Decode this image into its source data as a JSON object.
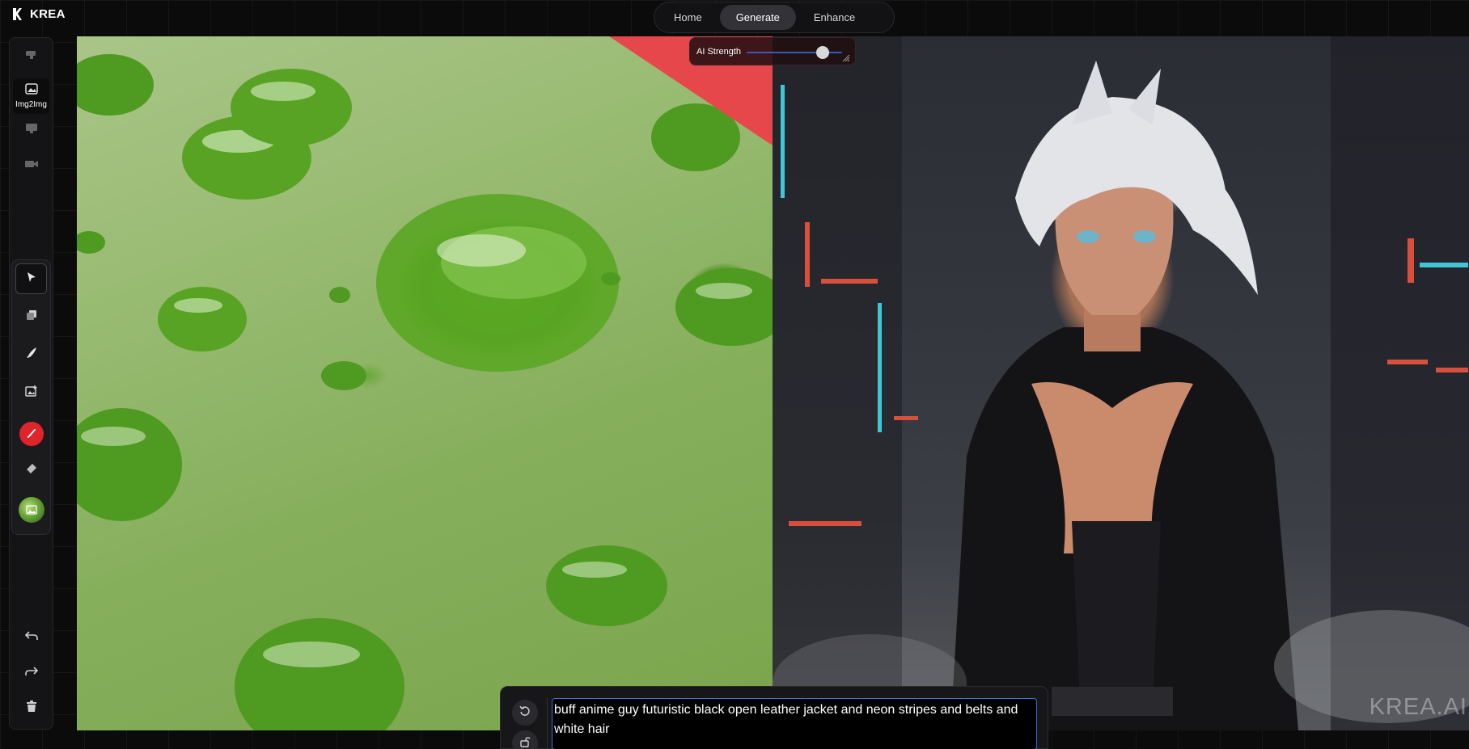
{
  "brand": {
    "name": "KREA"
  },
  "topnav": {
    "tabs": [
      {
        "label": "Home",
        "active": false
      },
      {
        "label": "Generate",
        "active": true
      },
      {
        "label": "Enhance",
        "active": false
      }
    ]
  },
  "sidebar": {
    "modes": [
      {
        "icon": "pen-tool-icon",
        "label": ""
      },
      {
        "icon": "image-icon",
        "label": "Img2Img",
        "active": true
      },
      {
        "icon": "monitor-icon",
        "label": ""
      },
      {
        "icon": "video-camera-icon",
        "label": ""
      }
    ],
    "tools": [
      {
        "icon": "select-cursor-icon",
        "active": true
      },
      {
        "icon": "layers-icon"
      },
      {
        "icon": "brush-icon"
      },
      {
        "icon": "image-add-icon"
      },
      {
        "icon": "color-picker-icon",
        "color": "#e0242c"
      },
      {
        "icon": "eraser-icon"
      },
      {
        "icon": "image-thumbnail-icon"
      }
    ],
    "bottom": [
      "undo-icon",
      "redo-icon",
      "trash-icon"
    ]
  },
  "ai_strength": {
    "label": "AI Strength",
    "value": 0.8
  },
  "prompt": {
    "text": "buff anime guy futuristic black open leather jacket and neon stripes and belts and white hair"
  },
  "watermark": "KREA.AI",
  "colors": {
    "accent": "#3e6fd1",
    "brush": "#e0242c",
    "panel": "#141416"
  }
}
